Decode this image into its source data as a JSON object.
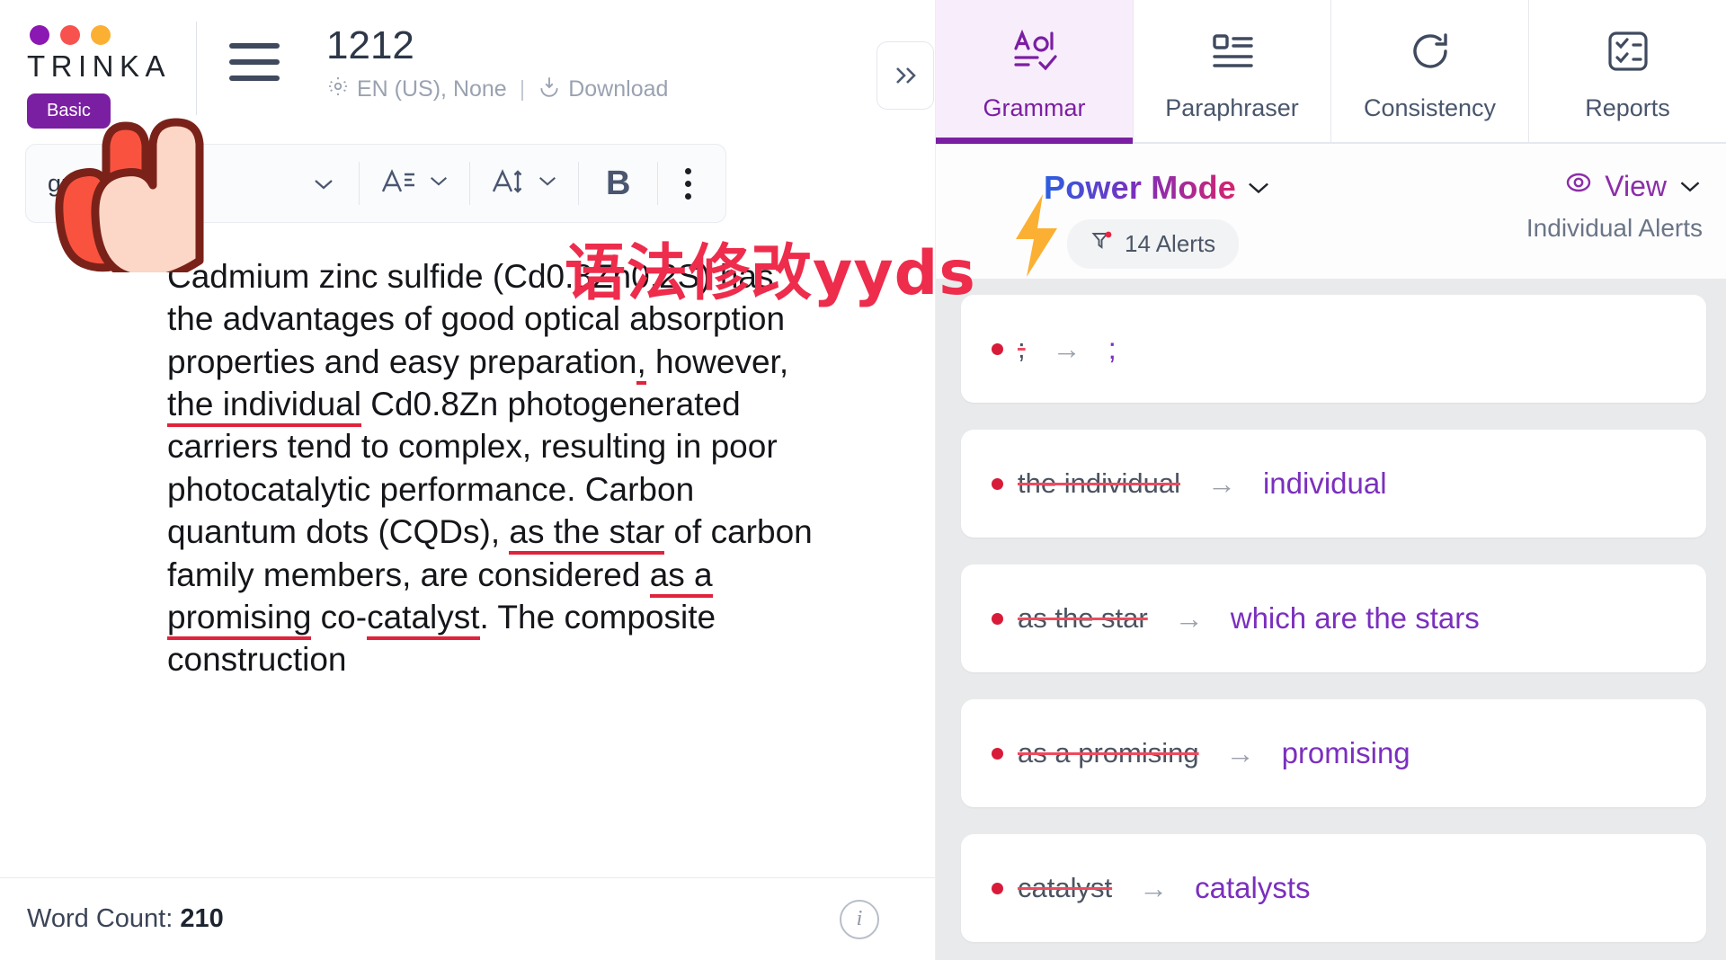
{
  "brand": {
    "name": "TRINKA",
    "plan_badge": "Basic",
    "dot_colors": [
      "#8b18b3",
      "#f8524e",
      "#fbb034"
    ]
  },
  "header": {
    "menu_icon": "hamburger-icon",
    "document_title": "1212",
    "language": "EN (US), None",
    "separator": "|",
    "download_label": "Download",
    "settings_icon": "gear-icon",
    "download_icon": "download-icon"
  },
  "toolbar": {
    "style_value": "graph",
    "style_full": "Paragraph",
    "font_family_icon": "font-family-icon",
    "font_size_icon": "font-size-icon",
    "bold_label": "B",
    "more_icon": "kebab-menu-icon"
  },
  "document": {
    "paragraph_parts": [
      {
        "text": "Cadmium zinc sulfide (Cd0.8Zn0.2S) has the advantages of good optical absorption properties and easy preparation",
        "style": "normal"
      },
      {
        "text": ",",
        "style": "error"
      },
      {
        "text": " however, ",
        "style": "normal"
      },
      {
        "text": "the individual",
        "style": "error"
      },
      {
        "text": " Cd0.8Zn photogenerated carriers tend to complex, resulting in poor photocatalytic performance. Carbon quantum dots (CQDs), ",
        "style": "normal"
      },
      {
        "text": "as the star",
        "style": "error"
      },
      {
        "text": " of carbon family members, are considered ",
        "style": "normal"
      },
      {
        "text": "as a promising",
        "style": "error"
      },
      {
        "text": " co-",
        "style": "normal"
      },
      {
        "text": "catalyst",
        "style": "error"
      },
      {
        "text": ". The composite construction",
        "style": "normal"
      }
    ]
  },
  "footer": {
    "word_count_label": "Word Count:",
    "word_count_value": "210",
    "info_icon": "info-icon"
  },
  "right_panel": {
    "collapse_icon": "double-chevron-right-icon",
    "tabs": [
      {
        "label": "Grammar",
        "icon": "grammar-check-icon",
        "active": true
      },
      {
        "label": "Paraphraser",
        "icon": "paraphrase-lines-icon",
        "active": false
      },
      {
        "label": "Consistency",
        "icon": "refresh-circle-icon",
        "active": false
      },
      {
        "label": "Reports",
        "icon": "checklist-icon",
        "active": false
      }
    ],
    "mode": {
      "bolt_icon": "lightning-bolt-icon",
      "name": "Power Mode",
      "chevron": "chevron-down-icon",
      "alerts_icon": "filter-alert-icon",
      "alerts_label": "14 Alerts"
    },
    "view": {
      "eye_icon": "eye-icon",
      "label": "View",
      "chevron": "chevron-down-icon",
      "sub_label": "Individual Alerts"
    },
    "suggestions": [
      {
        "original": ";",
        "replacement": ";"
      },
      {
        "original": "the individual",
        "replacement": "individual"
      },
      {
        "original": "as the star",
        "replacement": "which are the stars"
      },
      {
        "original": "as a promising",
        "replacement": "promising"
      },
      {
        "original": "catalyst",
        "replacement": "catalysts"
      }
    ]
  },
  "overlay": {
    "caption": "语法修改yyds",
    "caption_color": "#ee2c4c",
    "bolt_color": "#fbb034",
    "cursor_icon": "hand-cursor-icon"
  },
  "colors": {
    "brand_purple": "#7b1fa2",
    "accent_red": "#e0233c",
    "tab_active_bg": "#f8eefb",
    "card_bg": "#e9eaec"
  }
}
